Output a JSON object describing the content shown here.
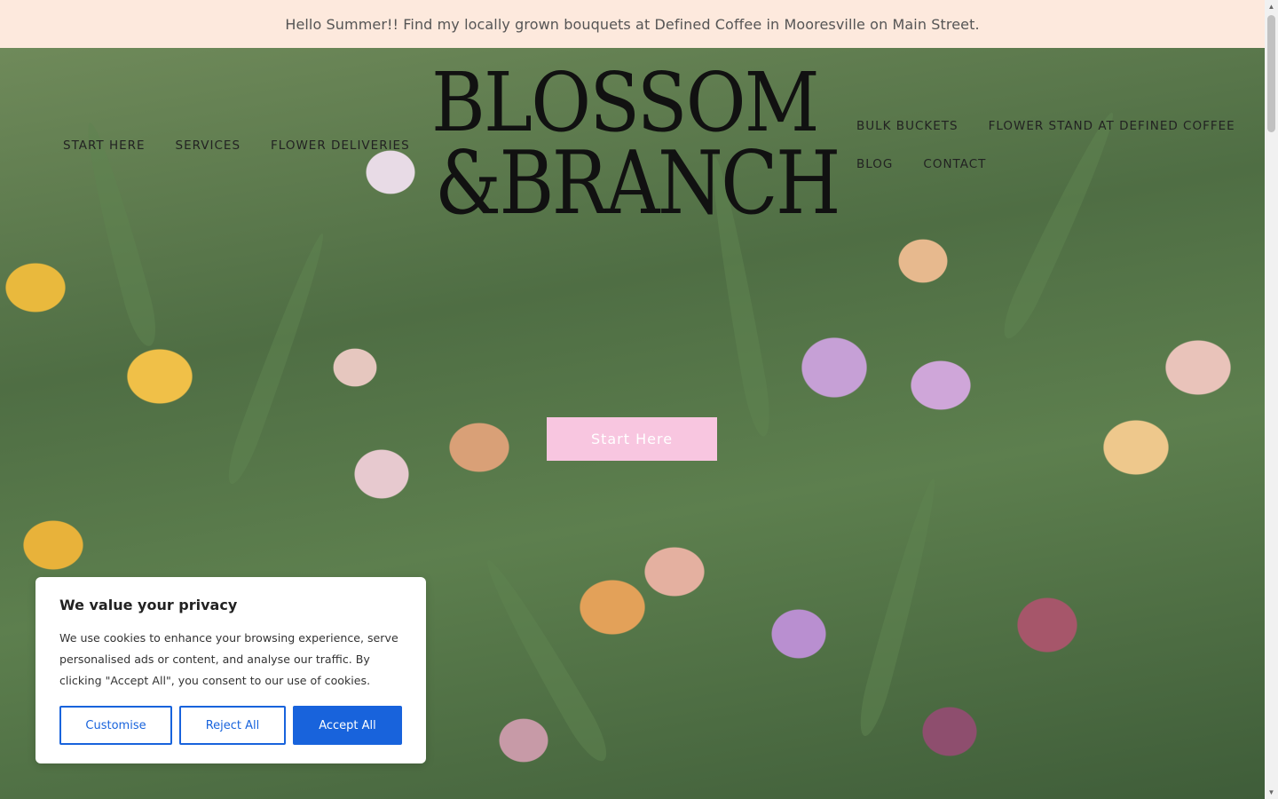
{
  "announcement": {
    "text": "Hello Summer!! Find my locally grown bouquets at Defined Coffee in Mooresville on Main Street."
  },
  "logo": {
    "line1": "BLOSSOM",
    "line2": "&BRANCH"
  },
  "nav": {
    "left": [
      "START HERE",
      "SERVICES",
      "FLOWER DELIVERIES"
    ],
    "right_row1": [
      "BULK BUCKETS",
      "FLOWER STAND AT DEFINED COFFEE"
    ],
    "right_row2": [
      "BLOG",
      "CONTACT"
    ]
  },
  "hero": {
    "cta_label": "Start Here"
  },
  "cookie": {
    "title": "We value your privacy",
    "body": "We use cookies to enhance your browsing experience, serve personalised ads or content, and analyse our traffic. By clicking \"Accept All\", you consent to our use of cookies.",
    "customise_label": "Customise",
    "reject_label": "Reject All",
    "accept_label": "Accept All"
  },
  "colors": {
    "announcement_bg": "#fde9dd",
    "cta_bg": "#f8c6e0",
    "accent": "#1863dc"
  },
  "icons": {
    "scroll_up": "triangle-up-icon",
    "scroll_down": "triangle-down-icon"
  }
}
